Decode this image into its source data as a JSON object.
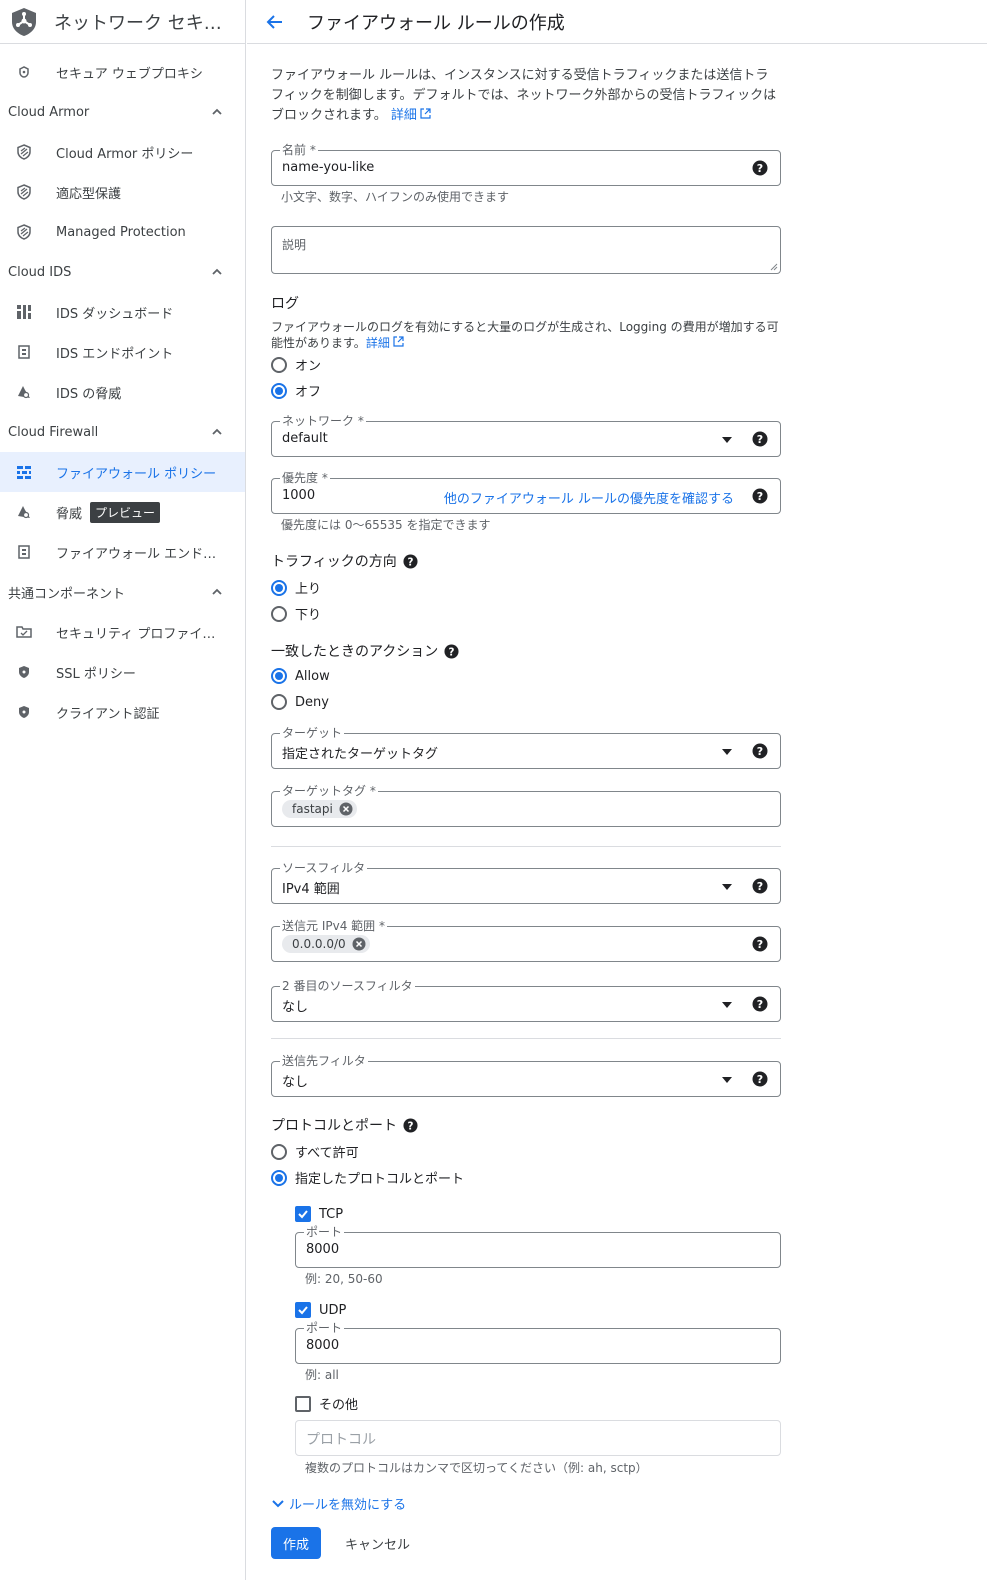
{
  "sidebar": {
    "title": "ネットワーク セキュ...",
    "top_item": "セキュア ウェブプロキシ",
    "sections": [
      {
        "label": "Cloud Armor",
        "items": [
          "Cloud Armor ポリシー",
          "適応型保護",
          "Managed Protection"
        ]
      },
      {
        "label": "Cloud IDS",
        "items": [
          "IDS ダッシュボード",
          "IDS エンドポイント",
          "IDS の脅威"
        ]
      },
      {
        "label": "Cloud Firewall",
        "items": [
          "ファイアウォール ポリシー",
          "脅威",
          "ファイアウォール エンドポ..."
        ],
        "badge": "プレビュー"
      },
      {
        "label": "共通コンポーネント",
        "items": [
          "セキュリティ プロファイル ...",
          "SSL ポリシー",
          "クライアント認証"
        ]
      }
    ]
  },
  "header": {
    "title": "ファイアウォール ルールの作成"
  },
  "intro": {
    "text": "ファイアウォール ルールは、インスタンスに対する受信トラフィックまたは送信トラフィックを制御します。デフォルトでは、ネットワーク外部からの受信トラフィックはブロックされます。",
    "link": "詳細"
  },
  "name_field": {
    "label": "名前 *",
    "value": "name-you-like",
    "hint": "小文字、数字、ハイフンのみ使用できます"
  },
  "description_field": {
    "placeholder": "説明"
  },
  "logs": {
    "title": "ログ",
    "text": "ファイアウォールのログを有効にすると大量のログが生成され、Logging の費用が増加する可能性があります。",
    "link": "詳細",
    "options": [
      "オン",
      "オフ"
    ],
    "selected": "オフ"
  },
  "network": {
    "label": "ネットワーク *",
    "value": "default"
  },
  "priority": {
    "label": "優先度 *",
    "value": "1000",
    "link": "他のファイアウォール ルールの優先度を確認する",
    "hint": "優先度には 0〜65535 を指定できます"
  },
  "direction": {
    "title": "トラフィックの方向",
    "options": [
      "上り",
      "下り"
    ],
    "selected": "上り"
  },
  "action": {
    "title": "一致したときのアクション",
    "options": [
      "Allow",
      "Deny"
    ],
    "selected": "Allow"
  },
  "target": {
    "label": "ターゲット",
    "value": "指定されたターゲットタグ"
  },
  "target_tags": {
    "label": "ターゲットタグ *",
    "chip": "fastapi"
  },
  "source_filter": {
    "label": "ソースフィルタ",
    "value": "IPv4 範囲"
  },
  "source_ipv4": {
    "label": "送信元 IPv4 範囲 *",
    "chip": "0.0.0.0/0"
  },
  "second_source": {
    "label": "2 番目のソースフィルタ",
    "value": "なし"
  },
  "dest_filter": {
    "label": "送信先フィルタ",
    "value": "なし"
  },
  "protocols": {
    "title": "プロトコルとポート",
    "options": [
      "すべて許可",
      "指定したプロトコルとポート"
    ],
    "selected": "指定したプロトコルとポート",
    "tcp": {
      "label": "TCP",
      "checked": true,
      "port_label": "ポート",
      "port_value": "8000",
      "hint": "例: 20, 50-60"
    },
    "udp": {
      "label": "UDP",
      "checked": true,
      "port_label": "ポート",
      "port_value": "8000",
      "hint": "例: all"
    },
    "other": {
      "label": "その他",
      "checked": false,
      "placeholder": "プロトコル",
      "hint": "複数のプロトコルはカンマで区切ってください（例: ah, sctp）"
    }
  },
  "disable_rule": "ルールを無効にする",
  "buttons": {
    "create": "作成",
    "cancel": "キャンセル"
  },
  "colors": {
    "accent": "#1a73e8",
    "active_bg": "#e8f0fe",
    "border": "#80868b"
  }
}
